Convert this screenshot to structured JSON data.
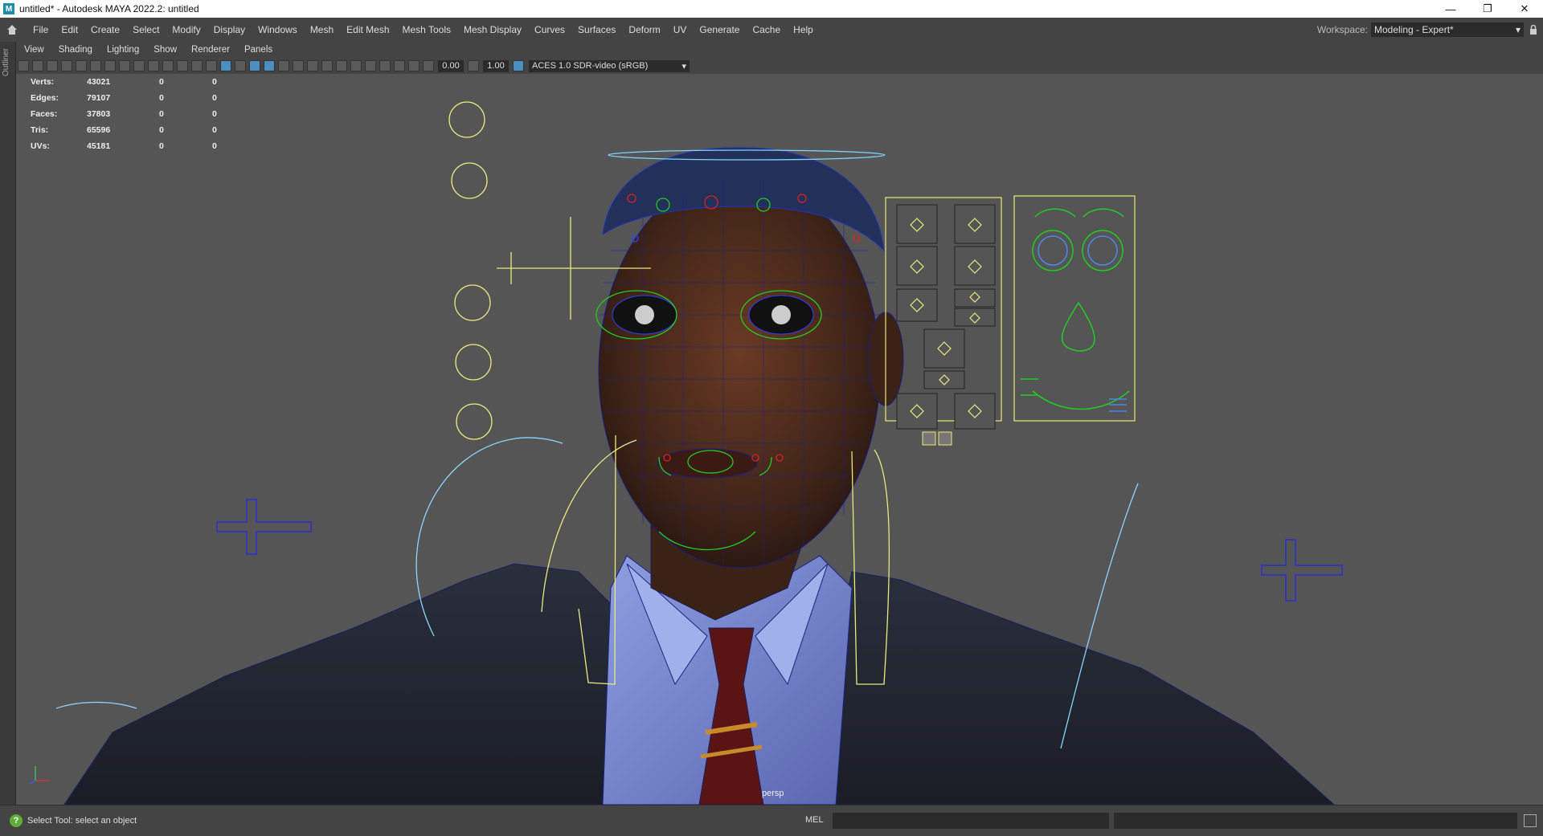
{
  "window": {
    "title": "untitled* - Autodesk MAYA 2022.2: untitled",
    "app_icon": "M",
    "minimize": "—",
    "restore": "❐",
    "close": "✕"
  },
  "menubar": {
    "items": [
      "File",
      "Edit",
      "Create",
      "Select",
      "Modify",
      "Display",
      "Windows",
      "Mesh",
      "Edit Mesh",
      "Mesh Tools",
      "Mesh Display",
      "Curves",
      "Surfaces",
      "Deform",
      "UV",
      "Generate",
      "Cache",
      "Help"
    ],
    "workspace_label": "Workspace:",
    "workspace_value": "Modeling - Expert*"
  },
  "outliner_tab": "Outliner",
  "panel_menu": [
    "View",
    "Shading",
    "Lighting",
    "Show",
    "Renderer",
    "Panels"
  ],
  "toolbar": {
    "exposure": "0.00",
    "gamma": "1.00",
    "color_space": "ACES 1.0 SDR-video (sRGB)"
  },
  "hud": {
    "rows": [
      {
        "label": "Verts:",
        "value": "43021",
        "a": "0",
        "b": "0"
      },
      {
        "label": "Edges:",
        "value": "79107",
        "a": "0",
        "b": "0"
      },
      {
        "label": "Faces:",
        "value": "37803",
        "a": "0",
        "b": "0"
      },
      {
        "label": "Tris:",
        "value": "65596",
        "a": "0",
        "b": "0"
      },
      {
        "label": "UVs:",
        "value": "45181",
        "a": "0",
        "b": "0"
      }
    ]
  },
  "viewport": {
    "camera": "persp"
  },
  "statusbar": {
    "help_text": "Select Tool: select an object",
    "mel_label": "MEL"
  }
}
